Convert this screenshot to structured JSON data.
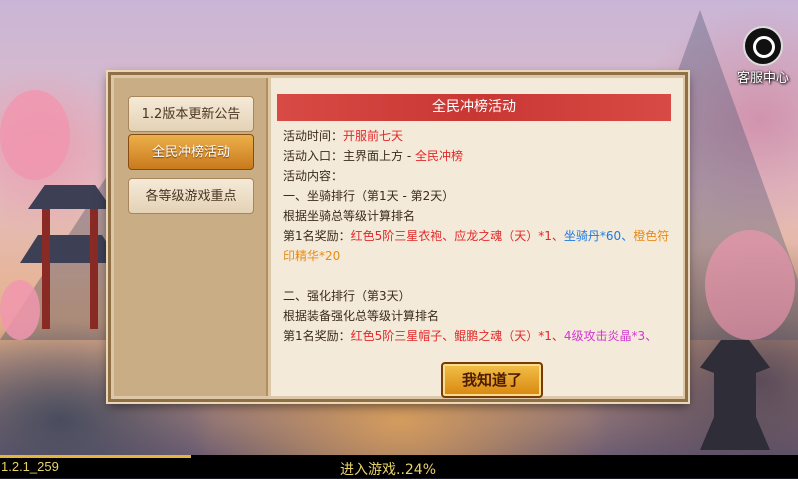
{
  "service": {
    "label": "客服中心",
    "icon": "headset-icon"
  },
  "sidebar": {
    "tabs": [
      {
        "label": "1.2版本更新公告",
        "active": false
      },
      {
        "label": "全民冲榜活动",
        "active": true
      },
      {
        "label": "各等级游戏重点",
        "active": false
      }
    ]
  },
  "content": {
    "title": "全民冲榜活动",
    "time_label": "活动时间：",
    "time_value": "开服前七天",
    "entry_label": "活动入口：主界面上方 - ",
    "entry_value": "全民冲榜",
    "content_label": "活动内容：",
    "section1": {
      "heading": "一、坐骑排行（第1天 - 第2天）",
      "desc": "根据坐骑总等级计算排名",
      "reward_label": "第1名奖励：",
      "reward_red": "红色5阶三星衣袍、应龙之魂（天）*1、",
      "reward_blue": "坐骑丹*60、",
      "reward_orange": "橙色符印精华*20"
    },
    "section2": {
      "heading": "二、强化排行（第3天）",
      "desc": "根据装备强化总等级计算排名",
      "reward_label": "第1名奖励：",
      "reward_red": "红色5阶三星帽子、鲲鹏之魂（天）*1、",
      "reward_purple": "4级攻击炎晶*3、"
    }
  },
  "confirm_button": "我知道了",
  "footer": {
    "version": "1.2.1_259",
    "loading_text": "进入游戏..24%",
    "progress_percent": 24
  },
  "colors": {
    "highlight_red": "#e2282a",
    "highlight_blue": "#1d7ae0",
    "highlight_orange": "#e98a16",
    "highlight_purple": "#d237d2",
    "title_bar": "#c93733",
    "active_tab": "#c97a1c"
  }
}
